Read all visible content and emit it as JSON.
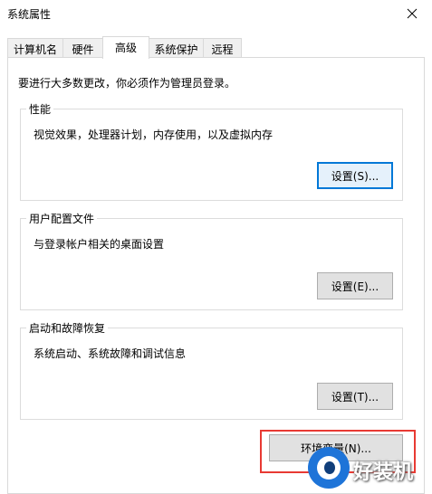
{
  "window": {
    "title": "系统属性"
  },
  "tabs": [
    {
      "label": "计算机名"
    },
    {
      "label": "硬件"
    },
    {
      "label": "高级"
    },
    {
      "label": "系统保护"
    },
    {
      "label": "远程"
    }
  ],
  "active_tab": "高级",
  "admin_note": "要进行大多数更改，你必须作为管理员登录。",
  "performance": {
    "label": "性能",
    "description": "视觉效果，处理器计划，内存使用，以及虚拟内存",
    "button": "设置(S)..."
  },
  "user_profiles": {
    "label": "用户配置文件",
    "description": "与登录帐户相关的桌面设置",
    "button": "设置(E)..."
  },
  "startup_recovery": {
    "label": "启动和故障恢复",
    "description": "系统启动、系统故障和调试信息",
    "button": "设置(T)..."
  },
  "env_button": "环境变量(N)...",
  "watermark": {
    "text": "好装机"
  },
  "colors": {
    "highlight_box": "#e83a33",
    "focus_border": "#0078d7",
    "watermark_blue": "#1e74d8"
  }
}
